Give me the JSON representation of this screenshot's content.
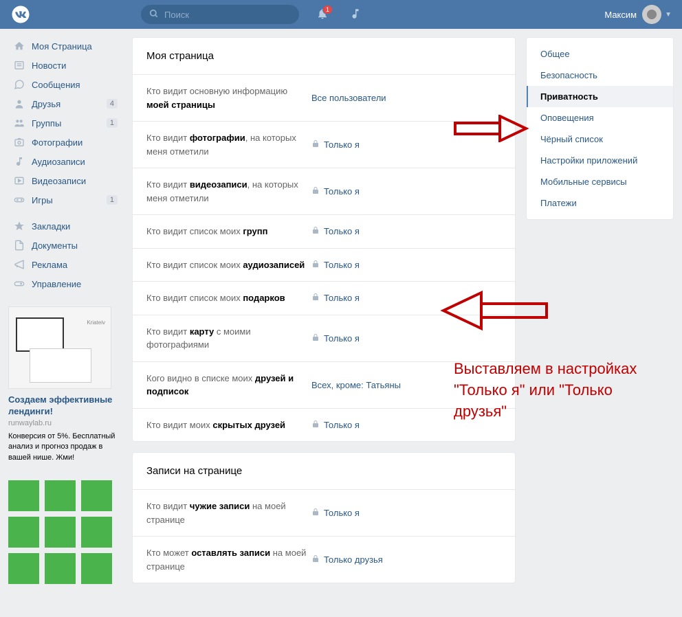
{
  "header": {
    "search_placeholder": "Поиск",
    "notif_count": "1",
    "username": "Максим"
  },
  "sidebar": {
    "items": [
      {
        "label": "Моя Страница",
        "icon": "home"
      },
      {
        "label": "Новости",
        "icon": "news"
      },
      {
        "label": "Сообщения",
        "icon": "msg"
      },
      {
        "label": "Друзья",
        "icon": "friends",
        "count": "4"
      },
      {
        "label": "Группы",
        "icon": "groups",
        "count": "1"
      },
      {
        "label": "Фотографии",
        "icon": "photo"
      },
      {
        "label": "Аудиозаписи",
        "icon": "audio"
      },
      {
        "label": "Видеозаписи",
        "icon": "video"
      },
      {
        "label": "Игры",
        "icon": "games",
        "count": "1"
      }
    ],
    "items2": [
      {
        "label": "Закладки",
        "icon": "star"
      },
      {
        "label": "Документы",
        "icon": "doc"
      },
      {
        "label": "Реклама",
        "icon": "ad"
      },
      {
        "label": "Управление",
        "icon": "manage"
      }
    ]
  },
  "ad": {
    "brand": "Kriateiv",
    "title": "Создаем эффективные лендинги!",
    "domain": "runwaylab.ru",
    "text": "Конверсия от 5%. Бесплатный анализ и прогноз продаж в вашей нише. Жми!"
  },
  "main": {
    "section1_title": "Моя страница",
    "section2_title": "Записи на странице",
    "settings1": [
      {
        "label_pre": "Кто видит основную информацию ",
        "label_bold": "моей страницы",
        "value": "Все пользователи",
        "lock": false
      },
      {
        "label_pre": "Кто видит ",
        "label_bold": "фотографии",
        "label_post": ", на которых меня отметили",
        "value": "Только я",
        "lock": true
      },
      {
        "label_pre": "Кто видит ",
        "label_bold": "видеозаписи",
        "label_post": ", на которых меня отметили",
        "value": "Только я",
        "lock": true
      },
      {
        "label_pre": "Кто видит список моих ",
        "label_bold": "групп",
        "value": "Только я",
        "lock": true
      },
      {
        "label_pre": "Кто видит список моих ",
        "label_bold": "аудиозаписей",
        "value": "Только я",
        "lock": true
      },
      {
        "label_pre": "Кто видит список моих ",
        "label_bold": "подарков",
        "value": "Только я",
        "lock": true
      },
      {
        "label_pre": "Кто видит ",
        "label_bold": "карту",
        "label_post": " с моими фотографиями",
        "value": "Только я",
        "lock": true
      },
      {
        "label_pre": "Кого видно в списке моих ",
        "label_bold": "друзей и подписок",
        "value": "Всех, кроме: Татьяны",
        "lock": false
      },
      {
        "label_pre": "Кто видит моих ",
        "label_bold": "скрытых друзей",
        "value": "Только я",
        "lock": true
      }
    ],
    "settings2": [
      {
        "label_pre": "Кто видит ",
        "label_bold": "чужие записи",
        "label_post": " на моей странице",
        "value": "Только я",
        "lock": true
      },
      {
        "label_pre": "Кто может ",
        "label_bold": "оставлять записи",
        "label_post": " на моей странице",
        "value": "Только друзья",
        "lock": true
      }
    ]
  },
  "tabs": [
    {
      "label": "Общее"
    },
    {
      "label": "Безопасность"
    },
    {
      "label": "Приватность",
      "active": true
    },
    {
      "label": "Оповещения"
    },
    {
      "label": "Чёрный список"
    },
    {
      "label": "Настройки приложений"
    },
    {
      "label": "Мобильные сервисы"
    },
    {
      "label": "Платежи"
    }
  ],
  "annotation": "Выставляем в настройках \"Только я\" или \"Только друзья\""
}
